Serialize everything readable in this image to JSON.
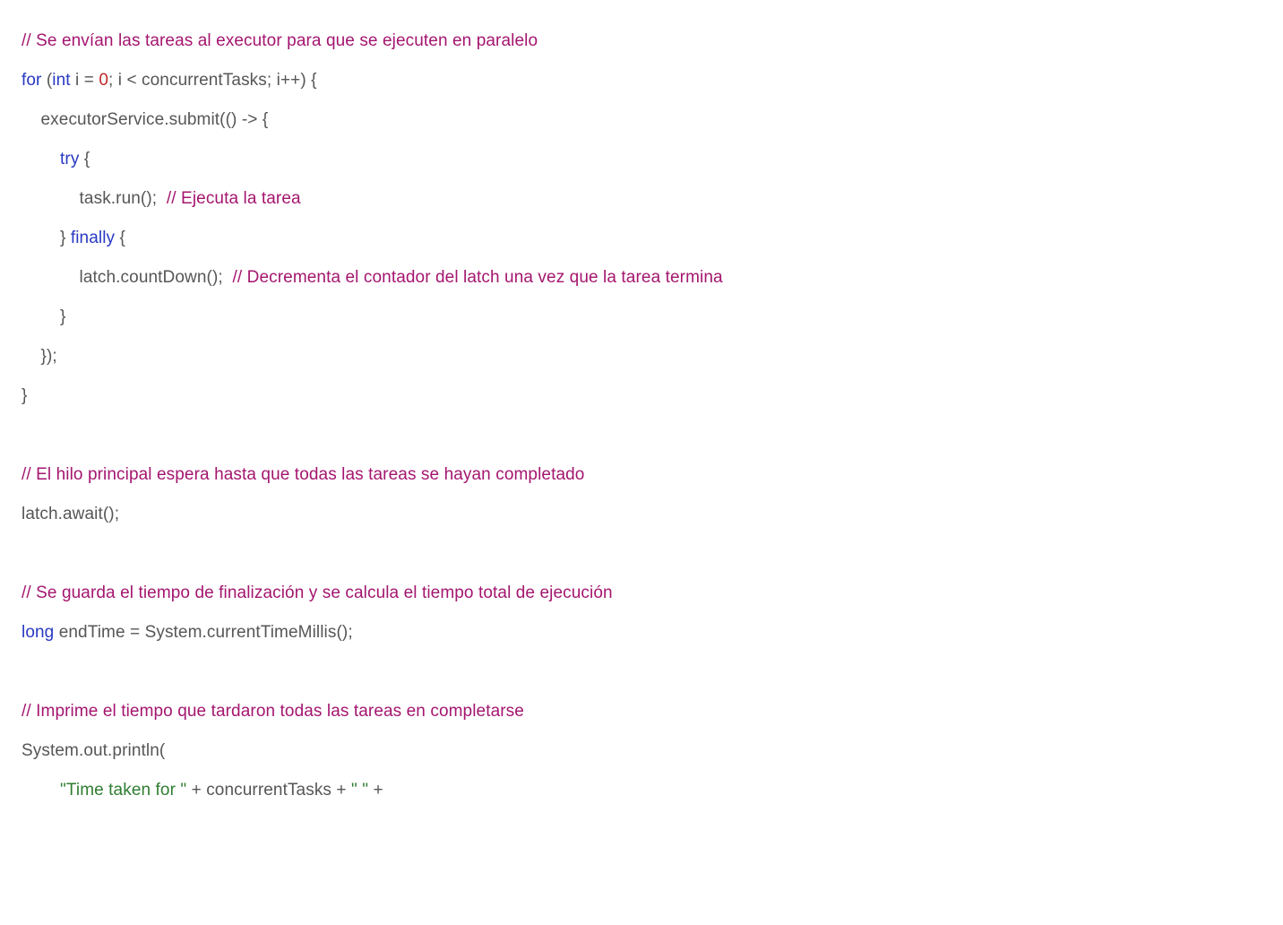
{
  "tokens": {
    "c1": "// Se envían las tareas al executor para que se ejecuten en paralelo",
    "kw_for": "for",
    "p_open": " (",
    "kw_int": "int",
    "loop_init": " i = ",
    "zero": "0",
    "loop_rest": "; i < concurrentTasks; i++) {",
    "submit_line": "    executorService.submit(() -> {",
    "indent2": "        ",
    "kw_try": "try",
    "brace_open": " {",
    "task_run_prefix": "            task.run();  ",
    "c_task": "// Ejecuta la tarea",
    "finally_prefix": "        } ",
    "kw_finally": "finally",
    "latch_cd_prefix": "            latch.countDown();  ",
    "c_latch": "// Decrementa el contador del latch una vez que la tarea termina",
    "close_inner": "        }",
    "close_lambda": "    });",
    "close_for": "}",
    "blank": "",
    "c2": "// El hilo principal espera hasta que todas las tareas se hayan completado",
    "await_line": "latch.await();",
    "c3": "// Se guarda el tiempo de finalización y se calcula el tiempo total de ejecución",
    "kw_long": "long",
    "endtime_rest": " endTime = System.currentTimeMillis();",
    "c4": "// Imprime el tiempo que tardaron todas las tareas en completarse",
    "println_line": "System.out.println(",
    "println_indent": "        ",
    "str1": "\"Time taken for \"",
    "plus_ct": " + concurrentTasks + ",
    "str2": "\" \"",
    "plus_end": " +"
  }
}
